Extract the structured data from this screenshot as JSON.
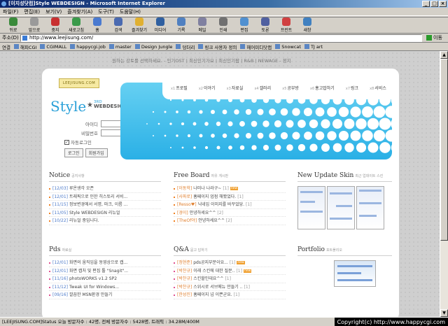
{
  "window": {
    "title": "[이지성닷컴]Style WEBDESIGN - Microsoft Internet Explorer",
    "controls": [
      "_",
      "□",
      "×"
    ]
  },
  "menu": [
    "파일(F)",
    "편집(E)",
    "보기(V)",
    "즐겨찾기(A)",
    "도구(T)",
    "도움말(H)"
  ],
  "toolbar": [
    {
      "label": "뒤로",
      "icon": "back-arrow-icon",
      "color": "#3a8a3a"
    },
    {
      "label": "앞으로",
      "icon": "forward-arrow-icon",
      "color": "#9a9a9a"
    },
    {
      "label": "중지",
      "icon": "stop-icon",
      "color": "#c83030"
    },
    {
      "label": "새로고침",
      "icon": "refresh-icon",
      "color": "#3a9a4a"
    },
    {
      "label": "홈",
      "icon": "home-icon",
      "color": "#4a7ad0"
    },
    {
      "label": "검색",
      "icon": "search-icon",
      "color": "#4a6ab0"
    },
    {
      "label": "즐겨찾기",
      "icon": "favorites-icon",
      "color": "#e0b030"
    },
    {
      "label": "미디어",
      "icon": "media-icon",
      "color": "#3060a0"
    },
    {
      "label": "기록",
      "icon": "history-icon",
      "color": "#5080c0"
    },
    {
      "label": "메일",
      "icon": "mail-icon",
      "color": "#8080a0"
    },
    {
      "label": "인쇄",
      "icon": "print-icon",
      "color": "#707070"
    },
    {
      "label": "편집",
      "icon": "edit-icon",
      "color": "#5090d0"
    },
    {
      "label": "토론",
      "icon": "discuss-icon",
      "color": "#5060a0"
    },
    {
      "label": "프린트",
      "icon": "printer-icon",
      "color": "#d04040"
    },
    {
      "label": "새창",
      "icon": "new-window-icon",
      "color": "#4080c0"
    }
  ],
  "address": {
    "label": "주소(D)",
    "url": "http://www.leejisung.com/",
    "go": "이동"
  },
  "links": [
    "연결",
    "해피CGI",
    "CGIMALL",
    "happycgi.job",
    "master",
    "Design Jungle",
    "덩더리",
    "링크 사용자 정의",
    "헤어미디닷컴",
    "Snowcat",
    "TJ art"
  ],
  "page": {
    "topnav": "원하는 강토를 선택하세요. - 인기OST | 최신인기가요 | 최신인기팝 | R&B | NEWAGE - 정지",
    "logo_text": "LEEJISUNG.COM",
    "brand": {
      "main": "Style",
      "star": "★",
      "small": "3RD",
      "sub": "WEBDESIGN"
    },
    "login": {
      "id_label": "아이디",
      "pw_label": "비밀번호",
      "auto_login": "자동로그인",
      "check": "✓",
      "login_btn": "로그인",
      "join_btn": "회원가입"
    },
    "nav": [
      {
        "num": "x1",
        "label": "프로필"
      },
      {
        "num": "x2",
        "label": "이야기"
      },
      {
        "num": "x3",
        "label": "자료실"
      },
      {
        "num": "x4",
        "label": "갤러리"
      },
      {
        "num": "x5",
        "label": "공부방"
      },
      {
        "num": "x6",
        "label": "홍고맙하기"
      },
      {
        "num": "x7",
        "label": "링크"
      },
      {
        "num": "x8",
        "label": "서비스"
      }
    ],
    "notice": {
      "title": "Notice",
      "sub": "공지사항",
      "items": [
        {
          "date": "[12/03]",
          "text": "루온생각 오픈"
        },
        {
          "date": "[12/01]",
          "text": "트래픽으로 인한 히스토리 서비..."
        },
        {
          "date": "[11/15]",
          "text": "정보변경에서 서명, 마크, 이름 ..."
        },
        {
          "date": "[11/05]",
          "text": "Style WEBDESIGN 리뉴얼"
        },
        {
          "date": "[10/22]",
          "text": "리뉴얼 중입니다."
        }
      ]
    },
    "freeboard": {
      "title": "Free Board",
      "sub": "자유 게시판",
      "items": [
        {
          "author": "[이동학]",
          "text": "나미나 나라구~",
          "count": "[1]",
          "isnew": "new"
        },
        {
          "author": "[사파로]",
          "text": "홈페이지 업점 해봤었다.",
          "count": "[1]",
          "isnew": ""
        },
        {
          "author": "[Resso♥]",
          "text": "닉네임 이미지를 바꾸었당.",
          "count": "[1]",
          "isnew": ""
        },
        {
          "author": "[경이]",
          "text": "안녕하세요^^",
          "count": "[2]",
          "isnew": ""
        },
        {
          "author": "[TheOf야]",
          "text": "안녕하세요^^",
          "count": "[2]",
          "isnew": ""
        }
      ]
    },
    "newskin": {
      "title": "New Update Skin",
      "sub": "최근 업데이트 스킨"
    },
    "pds": {
      "title": "Pds",
      "sub": "자료실",
      "items": [
        {
          "date": "[12/01]",
          "text": "화면의 움직임을 동영상으로 캡..."
        },
        {
          "date": "[12/01]",
          "text": "화면 캡처 및 편집 툴 \"Snagit\"..."
        },
        {
          "date": "[11/16]",
          "text": "photoWORKS v1.2 SP2"
        },
        {
          "date": "[11/12]",
          "text": "Tweak UI for Windows..."
        },
        {
          "date": "[09/16]",
          "text": "깔끔한 MSN환경 만들기"
        }
      ]
    },
    "qa": {
      "title": "Q&A",
      "sub": "묻고 답하기",
      "items": [
        {
          "author": "[정현준]",
          "text": "pds공지부분이요...",
          "count": "[1]",
          "isnew": "new"
        },
        {
          "author": "[박찬규]",
          "text": "이래 스킨에 대한 질문..",
          "count": "[1]",
          "isnew": "new"
        },
        {
          "author": "[박찬규]",
          "text": "스킨할인데요^^",
          "count": "[1]",
          "isnew": ""
        },
        {
          "author": "[박찬규]",
          "text": "스위시로 서브메뉴 만들기 ..",
          "count": "[1]",
          "isnew": ""
        },
        {
          "author": "[한성진]",
          "text": "홈페이지 넘 이쁜군요.",
          "count": "[1]",
          "isnew": ""
        }
      ]
    },
    "portfolio": {
      "title": "Portfolio",
      "sub": "포트폴리오"
    }
  },
  "status": {
    "text": "[LEEJISUNG.COM]Status 오늘 방문자수 : 42명, 전체 방문자수 : 5428명, 트래픽 : 34.28M/400M",
    "copyright": "Copyright(c) http://www.happycgi.com"
  },
  "colors": {
    "accent": "#2aa0d8",
    "titlebar": "#0a246a",
    "date": "#4b79c9",
    "author": "#e08030"
  }
}
